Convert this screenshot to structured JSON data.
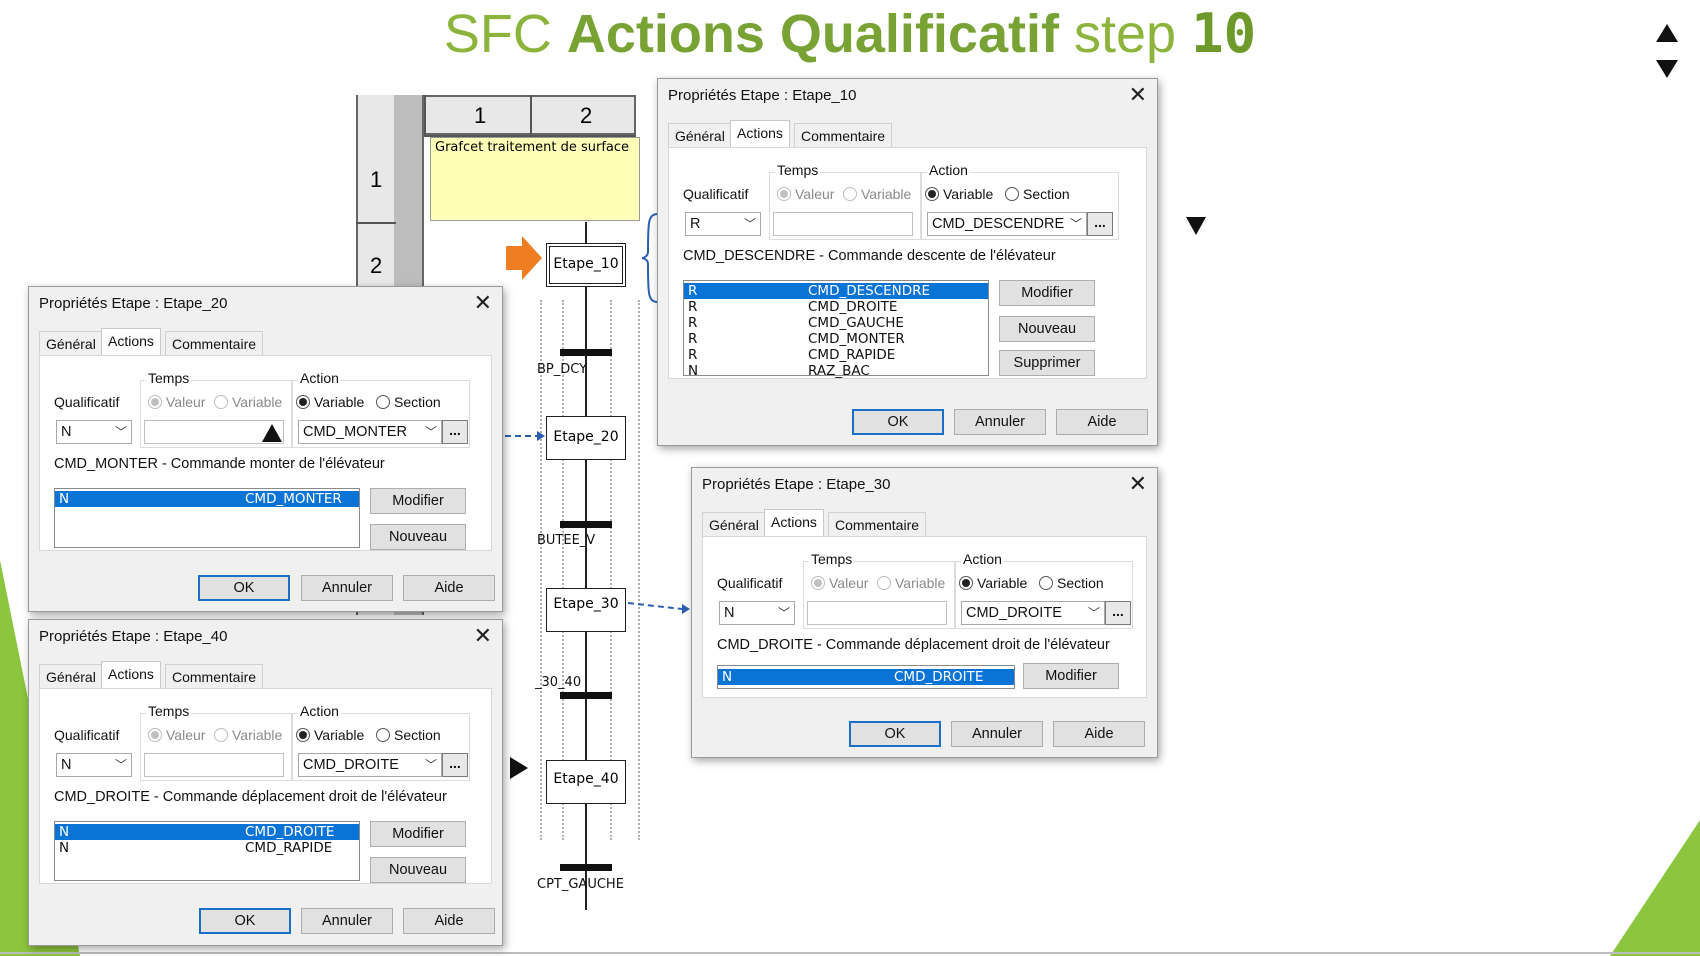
{
  "slide": {
    "title_prefix": "SFC",
    "title_bold": "Actions Qualificatif",
    "title_mid": "step",
    "title_num": "10"
  },
  "grid": {
    "col_headers": [
      "1",
      "2"
    ],
    "row_headers": [
      "1",
      "2"
    ],
    "comment": "Grafcet traitement de surface"
  },
  "grafcet": {
    "steps": [
      "Etape_10",
      "Etape_20",
      "Etape_30",
      "Etape_40"
    ],
    "transitions": [
      "BP_DCY",
      "BUTEE_V",
      "_30_40",
      "CPT_GAUCHE"
    ]
  },
  "dialogs": {
    "d10": {
      "title": "Propriétés Etape : Etape_10",
      "tabs": [
        "Général",
        "Actions",
        "Commentaire"
      ],
      "qualificatif_label": "Qualificatif",
      "temps_label": "Temps",
      "action_label": "Action",
      "valeur": "Valeur",
      "variable_t": "Variable",
      "variable_a": "Variable",
      "section": "Section",
      "qualificatif": "R",
      "action_value": "CMD_DESCENDRE",
      "description": "CMD_DESCENDRE - Commande descente de l'élévateur",
      "rows": [
        {
          "q": "R",
          "v": "CMD_DESCENDRE"
        },
        {
          "q": "R",
          "v": "CMD_DROITE"
        },
        {
          "q": "R",
          "v": "CMD_GAUCHE"
        },
        {
          "q": "R",
          "v": "CMD_MONTER"
        },
        {
          "q": "R",
          "v": "CMD_RAPIDE"
        },
        {
          "q": "N",
          "v": "RAZ_BAC"
        }
      ],
      "btn_modifier": "Modifier",
      "btn_nouveau": "Nouveau",
      "btn_supprimer": "Supprimer",
      "ok": "OK",
      "annuler": "Annuler",
      "aide": "Aide"
    },
    "d20": {
      "title": "Propriétés Etape : Etape_20",
      "tabs": [
        "Général",
        "Actions",
        "Commentaire"
      ],
      "qualificatif_label": "Qualificatif",
      "temps_label": "Temps",
      "action_label": "Action",
      "valeur": "Valeur",
      "variable_t": "Variable",
      "variable_a": "Variable",
      "section": "Section",
      "qualificatif": "N",
      "action_value": "CMD_MONTER",
      "description": "CMD_MONTER - Commande monter de l'élévateur",
      "rows": [
        {
          "q": "N",
          "v": "CMD_MONTER"
        }
      ],
      "btn_modifier": "Modifier",
      "btn_nouveau": "Nouveau",
      "ok": "OK",
      "annuler": "Annuler",
      "aide": "Aide"
    },
    "d30": {
      "title": "Propriétés Etape : Etape_30",
      "tabs": [
        "Général",
        "Actions",
        "Commentaire"
      ],
      "qualificatif_label": "Qualificatif",
      "temps_label": "Temps",
      "action_label": "Action",
      "valeur": "Valeur",
      "variable_t": "Variable",
      "variable_a": "Variable",
      "section": "Section",
      "qualificatif": "N",
      "action_value": "CMD_DROITE",
      "description": "CMD_DROITE - Commande déplacement droit de l'élévateur",
      "rows": [
        {
          "q": "N",
          "v": "CMD_DROITE"
        }
      ],
      "btn_modifier": "Modifier",
      "ok": "OK",
      "annuler": "Annuler",
      "aide": "Aide"
    },
    "d40": {
      "title": "Propriétés Etape : Etape_40",
      "tabs": [
        "Général",
        "Actions",
        "Commentaire"
      ],
      "qualificatif_label": "Qualificatif",
      "temps_label": "Temps",
      "action_label": "Action",
      "valeur": "Valeur",
      "variable_t": "Variable",
      "variable_a": "Variable",
      "section": "Section",
      "qualificatif": "N",
      "action_value": "CMD_DROITE",
      "description": "CMD_DROITE - Commande déplacement droit de l'élévateur",
      "rows": [
        {
          "q": "N",
          "v": "CMD_DROITE"
        },
        {
          "q": "N",
          "v": "CMD_RAPIDE"
        }
      ],
      "btn_modifier": "Modifier",
      "btn_nouveau": "Nouveau",
      "ok": "OK",
      "annuler": "Annuler",
      "aide": "Aide"
    }
  },
  "colors": {
    "accent_green": "#8cb33c",
    "selection": "#0a73d6",
    "arrow_orange": "#ef7d22"
  }
}
